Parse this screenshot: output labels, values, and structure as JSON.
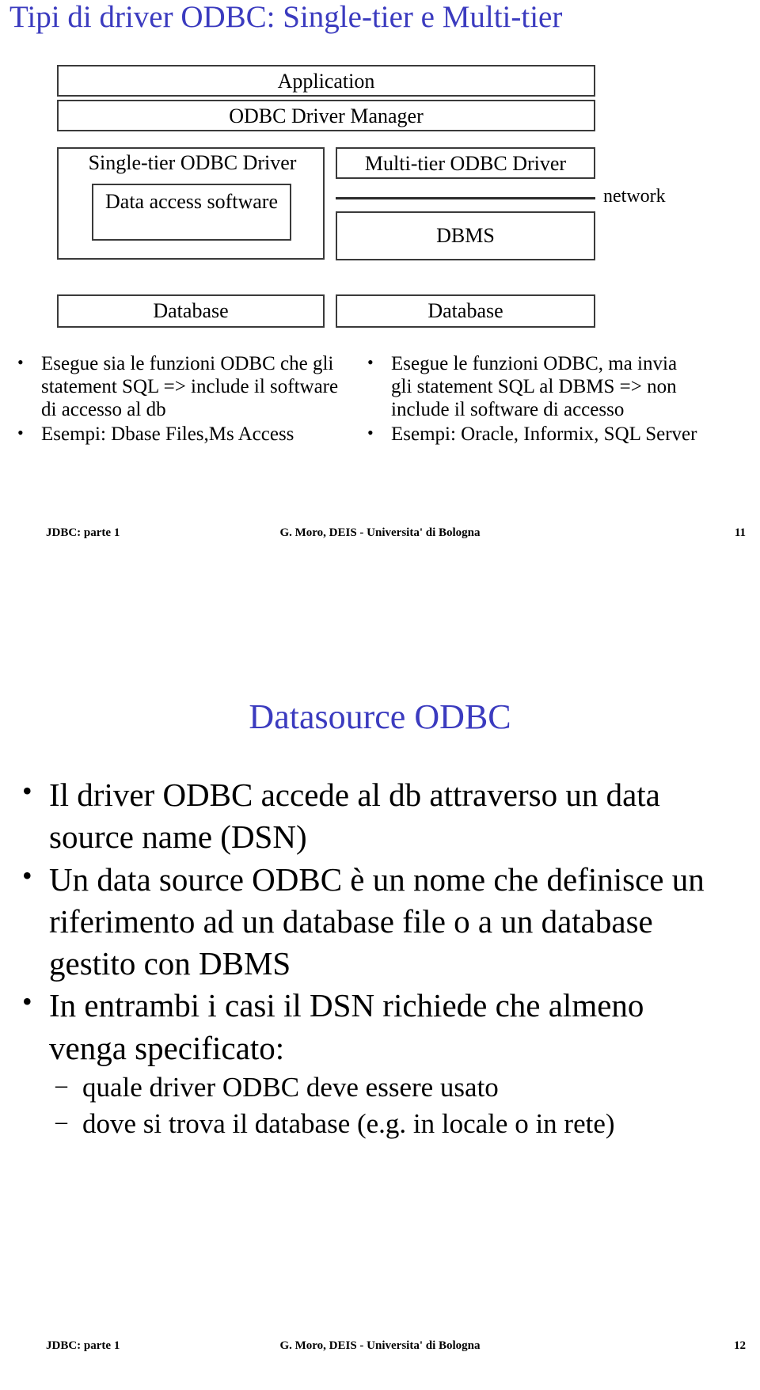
{
  "slide1": {
    "title": "Tipi di driver ODBC: Single-tier e Multi-tier",
    "title_color": "#3b3bbf",
    "diagram": {
      "application_box": "Application",
      "driver_manager_box": "ODBC Driver Manager",
      "single_tier_label": "Single-tier ODBC Driver",
      "data_access_box": "Data access software",
      "multi_tier_label": "Multi-tier ODBC Driver",
      "network_label": "network",
      "dbms_box": "DBMS",
      "database_left_box": "Database",
      "database_right_box": "Database"
    },
    "left_column": [
      "Esegue sia le funzioni ODBC che gli statement SQL => include il software di accesso al db",
      "Esempi: Dbase Files,Ms Access"
    ],
    "right_column": [
      "Esegue le funzioni ODBC, ma invia gli statement SQL al DBMS => non include il software di accesso",
      "Esempi: Oracle, Informix, SQL Server"
    ],
    "footer": {
      "left": "JDBC: parte 1",
      "center": "G. Moro, DEIS - Universita' di Bologna",
      "page": "11"
    }
  },
  "slide2": {
    "title": "Datasource ODBC",
    "title_color": "#3b3bbf",
    "bullets": [
      "Il driver ODBC accede al db attraverso un data source name (DSN)",
      "Un data source ODBC è un nome che definisce un riferimento ad un database file o a un database gestito con DBMS",
      "In entrambi i casi il DSN richiede che almeno venga specificato:"
    ],
    "sub_bullets": [
      "quale driver ODBC deve essere usato",
      "dove si trova il database (e.g. in locale o in rete)"
    ],
    "footer": {
      "left": "JDBC: parte 1",
      "center": "G. Moro, DEIS - Universita' di Bologna",
      "page": "12"
    }
  }
}
